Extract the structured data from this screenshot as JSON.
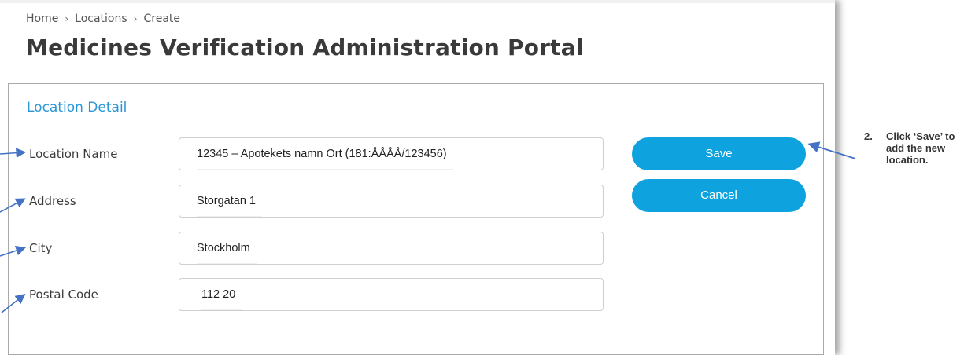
{
  "breadcrumb": {
    "items": [
      "Home",
      "Locations",
      "Create"
    ],
    "separator": "›"
  },
  "page_title": "Medicines Verification Administration Portal",
  "section_title": "Location Detail",
  "form": {
    "location_name": {
      "label": "Location Name",
      "value": "12345 – Apotekets namn Ort (181:ÅÅÅÅ/123456)"
    },
    "address": {
      "label": "Address",
      "value": "Storgatan 1"
    },
    "city": {
      "label": "City",
      "value": "Stockholm"
    },
    "postal_code": {
      "label": "Postal Code",
      "value": "112 20"
    }
  },
  "buttons": {
    "save": "Save",
    "cancel": "Cancel"
  },
  "annotation": {
    "number": "2.",
    "text": "Click ‘Save’ to add the new location."
  },
  "colors": {
    "accent": "#0ea3df",
    "section_title": "#2a95d8",
    "arrow": "#4472c4"
  }
}
